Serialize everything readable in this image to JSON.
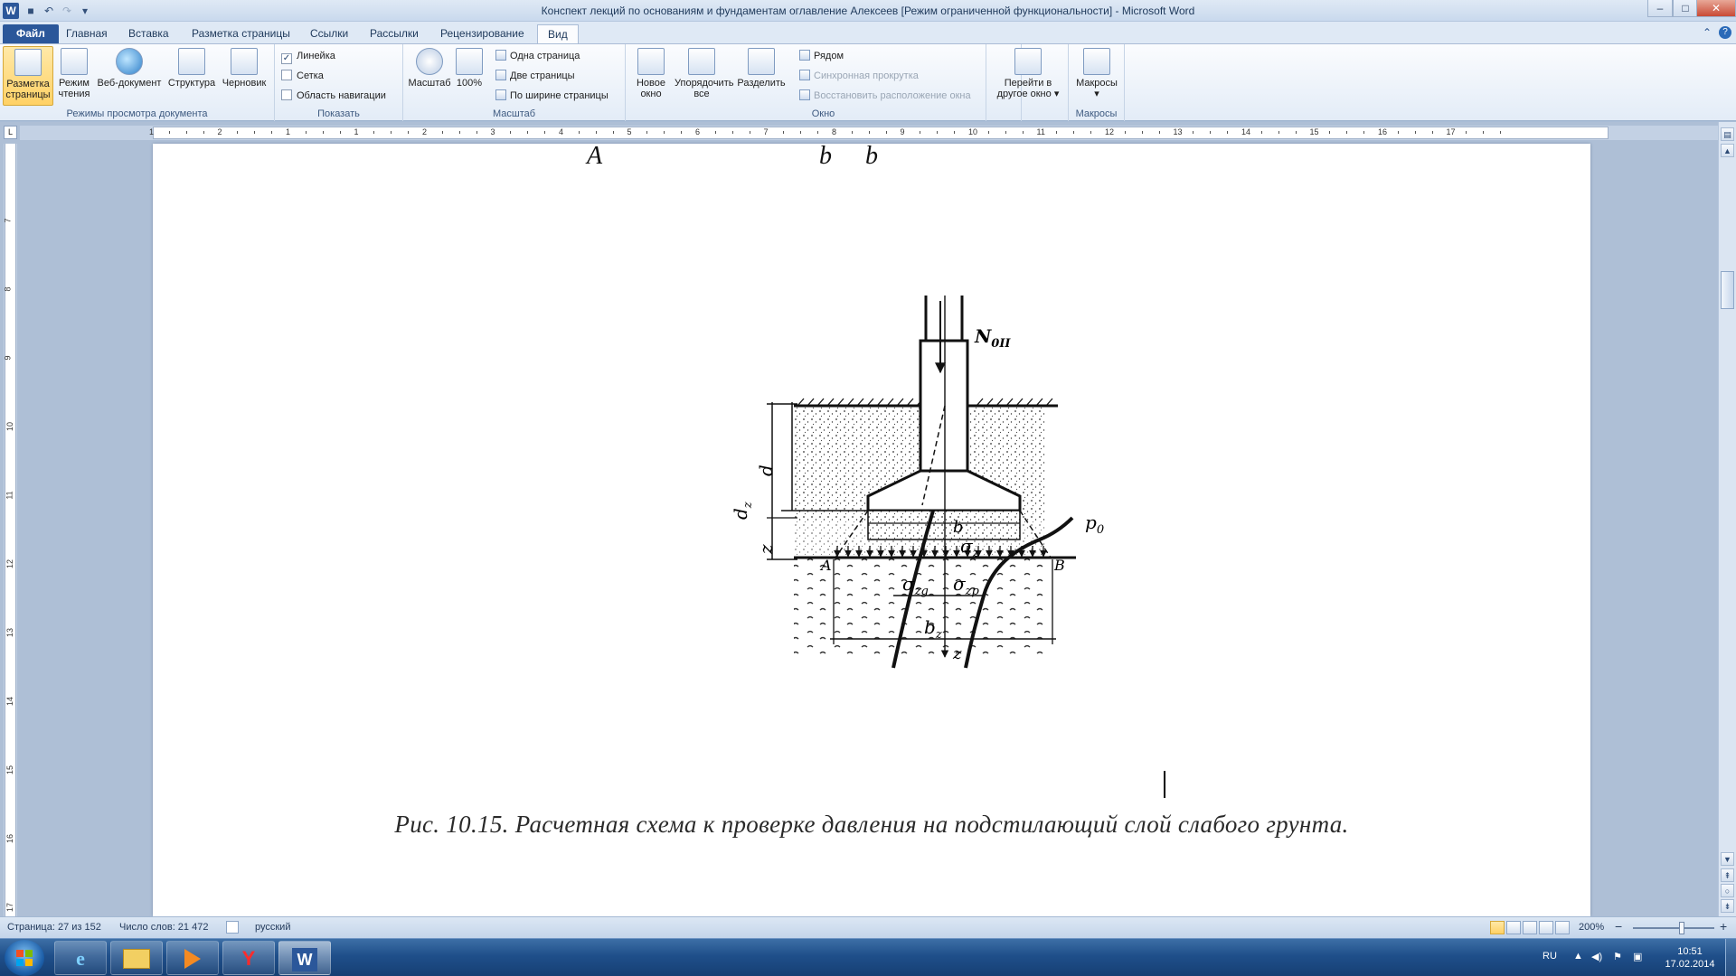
{
  "titlebar": {
    "title": "Конспект лекций по основаниям и фундаментам оглавление Алексеев [Режим ограниченной функциональности]  -  Microsoft Word",
    "app_logo": "W",
    "minimize": "–",
    "maximize": "□",
    "close": "✕"
  },
  "tabs": [
    {
      "label": "Файл"
    },
    {
      "label": "Главная"
    },
    {
      "label": "Вставка"
    },
    {
      "label": "Разметка страницы"
    },
    {
      "label": "Ссылки"
    },
    {
      "label": "Рассылки"
    },
    {
      "label": "Рецензирование"
    },
    {
      "label": "Вид"
    }
  ],
  "ribbon": {
    "groups": {
      "views": {
        "label": "Режимы просмотра документа",
        "print_layout": "Разметка страницы",
        "reading": "Режим чтения",
        "web": "Веб-документ",
        "outline": "Структура",
        "draft": "Черновик"
      },
      "show": {
        "label": "Показать",
        "ruler": "Линейка",
        "grid": "Сетка",
        "nav": "Область навигации",
        "ruler_check": "✓"
      },
      "zoom": {
        "label": "Масштаб",
        "zoom": "Масштаб",
        "hundred": "100%",
        "one_page": "Одна страница",
        "two_pages": "Две страницы",
        "page_width": "По ширине страницы"
      },
      "window": {
        "label": "Окно",
        "new_window": "Новое окно",
        "arrange_all": "Упорядочить все",
        "split": "Разделить",
        "side_by_side": "Рядом",
        "sync_scroll": "Синхронная прокрутка",
        "reset_position": "Восстановить расположение окна",
        "switch_windows": "Перейти в другое окно"
      },
      "macros": {
        "label": "Макросы",
        "macros": "Макросы"
      }
    }
  },
  "ruler": {
    "h_numbers": [
      "1",
      "2",
      "1",
      "1",
      "2",
      "3",
      "4",
      "5",
      "6",
      "7",
      "8",
      "9",
      "10",
      "11",
      "12",
      "13",
      "14",
      "15",
      "16",
      "17"
    ],
    "v_numbers": [
      "7",
      "8",
      "9",
      "10",
      "11",
      "12",
      "13",
      "14",
      "15",
      "16",
      "17"
    ]
  },
  "document": {
    "top_fragments": [
      "A",
      "b",
      "b"
    ],
    "figure_labels": {
      "force": "N",
      "force_sub": "0II",
      "depth": "d",
      "depth_z": "d",
      "depth_z_sub": "z",
      "z_left": "z",
      "width_b": "b",
      "p0": "p",
      "p0_sub": "0",
      "sigma_z": "σ",
      "sigma_z_sub": "z",
      "point_a": "A",
      "point_b": "B",
      "sigma_zg": "σ",
      "sigma_zg_sub": "zg",
      "sigma_zp": "σ",
      "sigma_zp_sub": "zp",
      "width_bz": "b",
      "width_bz_sub": "z",
      "axis_z": "z"
    },
    "caption": "Рис. 10.15. Расчетная схема к проверке давления на подстилающий слой слабого грунта."
  },
  "statusbar": {
    "page": "Страница: 27 из 152",
    "words": "Число слов: 21 472",
    "language": "русский",
    "zoom": "200%",
    "zoom_minus": "−",
    "zoom_plus": "+"
  },
  "taskbar": {
    "yandex": "Y",
    "word": "W",
    "lang": "RU",
    "time": "10:51",
    "date": "17.02.2014"
  }
}
